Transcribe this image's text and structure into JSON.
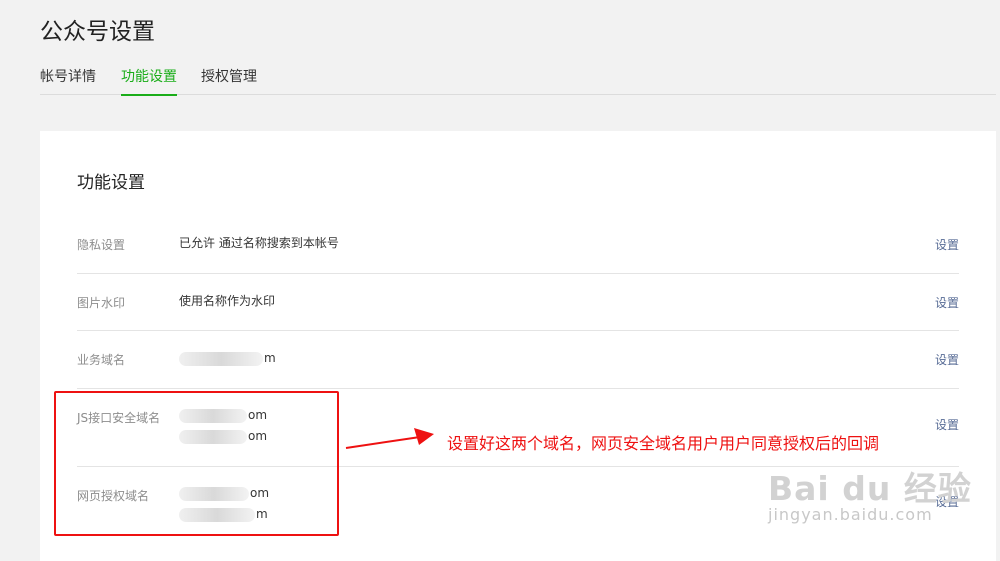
{
  "page": {
    "title": "公众号设置"
  },
  "tabs": [
    {
      "label": "帐号详情",
      "active": false
    },
    {
      "label": "功能设置",
      "active": true
    },
    {
      "label": "授权管理",
      "active": false
    }
  ],
  "card": {
    "title": "功能设置",
    "rows": [
      {
        "label": "隐私设置",
        "value": "已允许 通过名称搜索到本帐号",
        "action": "设置"
      },
      {
        "label": "图片水印",
        "value": "使用名称作为水印",
        "action": "设置"
      },
      {
        "label": "业务域名",
        "values": [
          "m"
        ],
        "action": "设置"
      },
      {
        "label": "JS接口安全域名",
        "values": [
          "om",
          "om"
        ],
        "action": "设置"
      },
      {
        "label": "网页授权域名",
        "values": [
          "om",
          "m"
        ],
        "action": "设置"
      }
    ]
  },
  "annotation": {
    "text": "设置好这两个域名，网页安全域名用户用户同意授权后的回调",
    "color": "#ee1111"
  },
  "watermark": {
    "logo": "Bai du 经验",
    "url": "jingyan.baidu.com"
  },
  "colors": {
    "accent": "#1aad19",
    "link": "#576b95",
    "highlight": "#ee1111"
  }
}
